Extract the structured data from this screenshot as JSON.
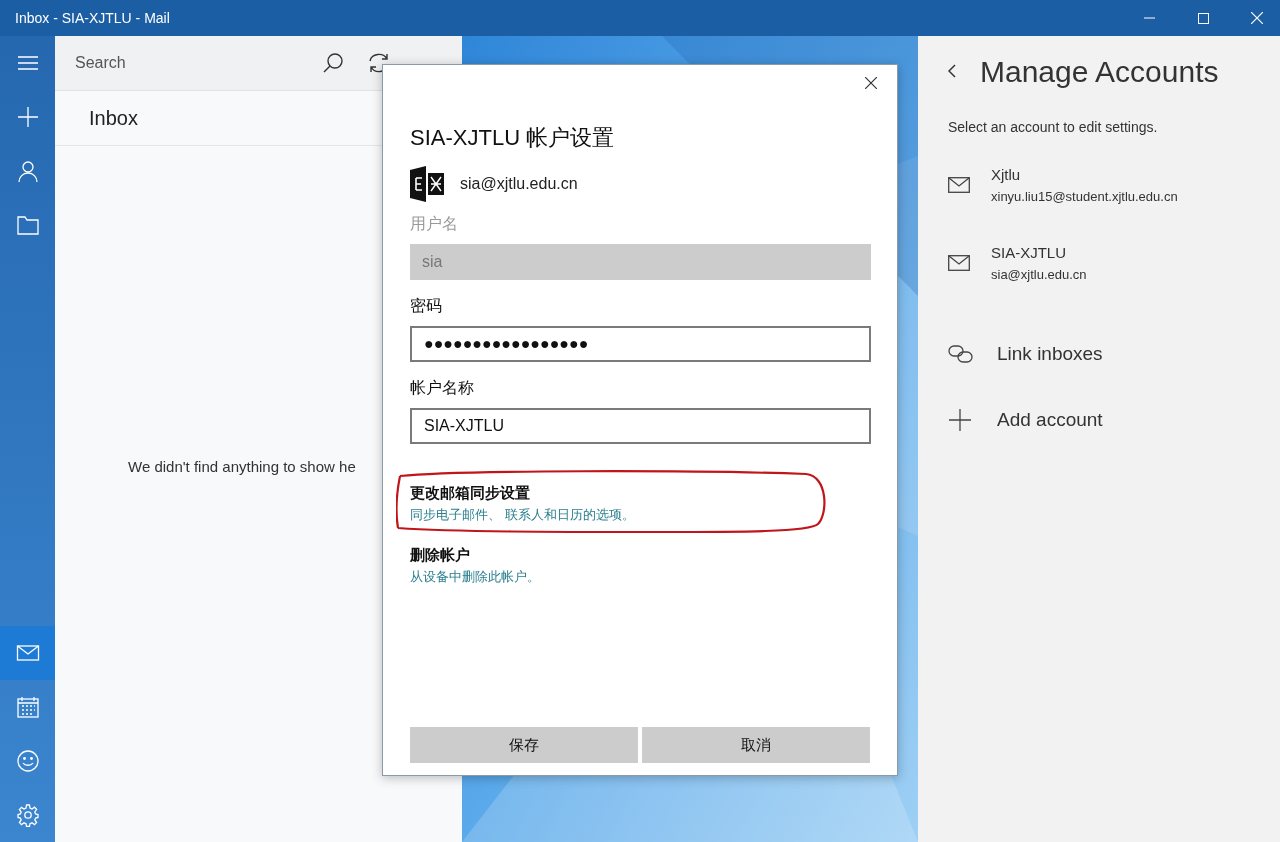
{
  "window": {
    "title": "Inbox - SIA-XJTLU - Mail"
  },
  "nav_rail": {
    "top": [
      {
        "kind": "menu",
        "selected": false
      },
      {
        "kind": "compose",
        "selected": false
      },
      {
        "kind": "people",
        "selected": false
      },
      {
        "kind": "folder",
        "selected": false
      }
    ],
    "bottom": [
      {
        "kind": "mail",
        "selected": true
      },
      {
        "kind": "calendar",
        "selected": false
      },
      {
        "kind": "feedback",
        "selected": false
      },
      {
        "kind": "settings",
        "selected": false
      }
    ]
  },
  "message_list": {
    "search": {
      "placeholder": "Search"
    },
    "folder_title": "Inbox",
    "empty_message": "We didn't find anything to show he"
  },
  "dialog": {
    "title": "SIA-XJTLU 帐户设置",
    "account_email": "sia@xjtlu.edu.cn",
    "fields": [
      {
        "label": "用户名",
        "value": "sia",
        "disabled": true
      },
      {
        "label": "密码",
        "value": "●●●●●●●●●●●●●●●●●",
        "disabled": false
      },
      {
        "label": "帐户名称",
        "value": "SIA-XJTLU",
        "disabled": false
      }
    ],
    "links": [
      {
        "title": "更改邮箱同步设置",
        "description": "同步电子邮件、 联系人和日历的选项。",
        "annotated": true
      },
      {
        "title": "删除帐户",
        "description": "从设备中删除此帐户。",
        "annotated": false
      }
    ],
    "buttons": [
      "保存",
      "取消"
    ]
  },
  "manage_accounts": {
    "title": "Manage Accounts",
    "subtitle": "Select an account to edit settings.",
    "accounts": [
      {
        "name": "Xjtlu",
        "email": "xinyu.liu15@student.xjtlu.edu.cn"
      },
      {
        "name": "SIA-XJTLU",
        "email": "sia@xjtlu.edu.cn"
      }
    ],
    "actions": [
      {
        "kind": "link",
        "label": "Link inboxes"
      },
      {
        "kind": "add",
        "label": "Add account"
      }
    ]
  }
}
